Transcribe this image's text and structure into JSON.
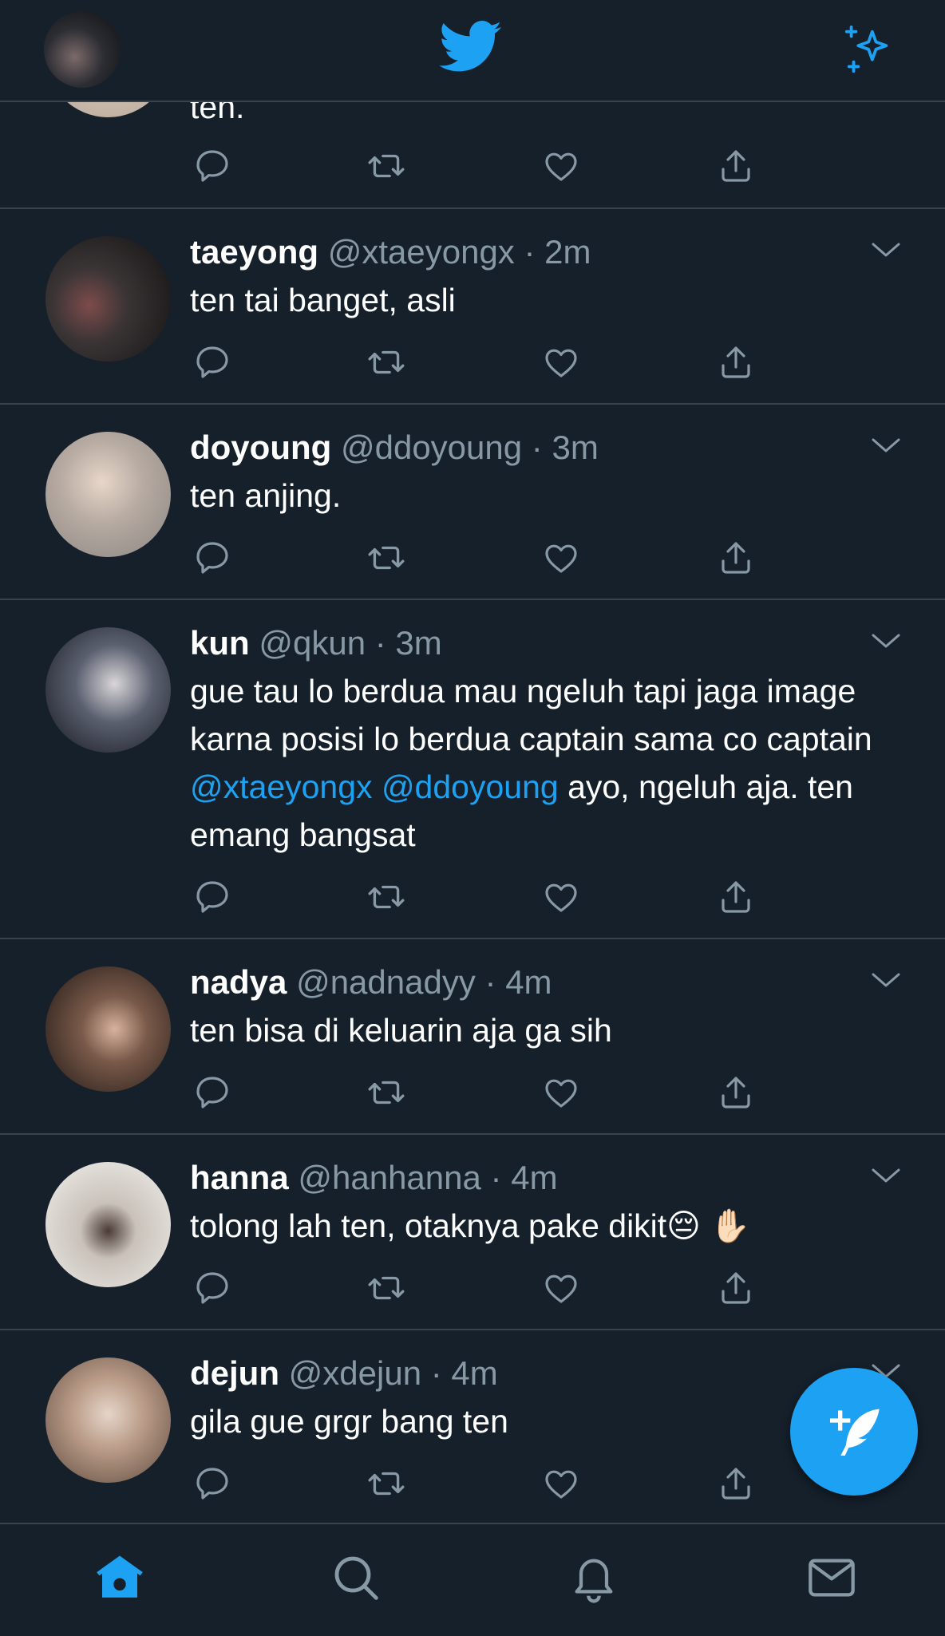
{
  "top": {
    "avatar": "profile-avatar",
    "logo": "twitter-bird-icon",
    "sparkle": "sparkle-icon"
  },
  "partial_tweet": {
    "text": "ten."
  },
  "tweets": [
    {
      "name": "taeyong",
      "handle": "@xtaeyongx",
      "dot": "·",
      "time": "2m",
      "text": "ten tai banget, asli"
    },
    {
      "name": "doyoung",
      "handle": "@ddoyoung",
      "dot": "·",
      "time": "3m",
      "text": "ten anjing."
    },
    {
      "name": "kun",
      "handle": "@qkun",
      "dot": "·",
      "time": "3m",
      "text_part1": "gue tau lo berdua mau ngeluh tapi jaga image karna posisi lo berdua captain sama co captain ",
      "mention1": "@xtaeyongx",
      "mention2": "@ddoyoung",
      "text_part2": " ayo, ngeluh aja. ten emang bangsat"
    },
    {
      "name": "nadya",
      "handle": "@nadnadyy",
      "dot": "·",
      "time": "4m",
      "text": "ten bisa di keluarin aja ga sih"
    },
    {
      "name": "hanna",
      "handle": "@hanhanna",
      "dot": "·",
      "time": "4m",
      "text": "tolong lah ten, otaknya pake dikit😔 ✋🏻"
    },
    {
      "name": "dejun",
      "handle": "@xdejun",
      "dot": "·",
      "time": "4m",
      "text": "gila gue grgr bang ten"
    }
  ],
  "colors": {
    "background": "#15202b",
    "accent": "#1da1f2",
    "muted": "#8899a6",
    "divider": "#38444d"
  },
  "tabs": [
    "home-icon",
    "search-icon",
    "notifications-icon",
    "messages-icon"
  ]
}
